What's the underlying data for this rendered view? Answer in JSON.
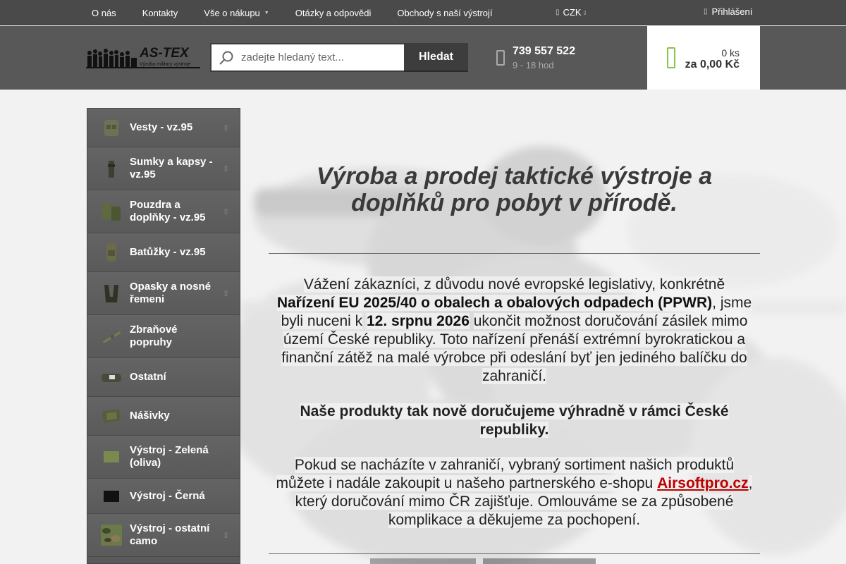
{
  "topnav": {
    "items": [
      {
        "label": "O nás",
        "dropdown": false
      },
      {
        "label": "Kontakty",
        "dropdown": false
      },
      {
        "label": "Vše o nákupu",
        "dropdown": true
      },
      {
        "label": "Otázky a odpovědi",
        "dropdown": false
      },
      {
        "label": "Obchody s naší výstrojí",
        "dropdown": false
      }
    ],
    "currency": "CZK",
    "login": "Přihlášení"
  },
  "header": {
    "logo_text": "AS-TEX",
    "logo_subtext": "Výroba military výstroje",
    "search_placeholder": "zadejte hledaný text...",
    "search_button": "Hledat",
    "phone": "739 557 522",
    "hours": "9 - 18 hod",
    "cart_qty": "0 ks",
    "cart_price": "za 0,00 Kč"
  },
  "sidebar": {
    "items": [
      {
        "label": "Vesty - vz.95",
        "submenu": true,
        "icon": "vest-icon",
        "color": "#6b7353"
      },
      {
        "label": "Sumky a kapsy - vz.95",
        "submenu": true,
        "icon": "pouch-icon",
        "color": "#3d4030"
      },
      {
        "label": "Pouzdra a doplňky - vz.95",
        "submenu": true,
        "icon": "holster-icon",
        "color": "#5e6a3e"
      },
      {
        "label": "Batůžky - vz.95",
        "submenu": false,
        "icon": "backpack-icon",
        "color": "#6b6a4a"
      },
      {
        "label": "Opasky a nosné řemeni",
        "submenu": true,
        "icon": "belt-icon",
        "color": "#2e3324"
      },
      {
        "label": "Zbraňové popruhy",
        "submenu": false,
        "icon": "sling-icon",
        "color": "#7a7a50"
      },
      {
        "label": "Ostatní",
        "submenu": false,
        "icon": "misc-icon",
        "color": "#4a4a3a"
      },
      {
        "label": "Nášivky",
        "submenu": false,
        "icon": "patch-icon",
        "color": "#585c3a"
      },
      {
        "label": "Výstroj - Zelená (oliva)",
        "submenu": false,
        "icon": "olive-swatch-icon",
        "color": "#7a8a4e"
      },
      {
        "label": "Výstroj - Černá",
        "submenu": false,
        "icon": "black-swatch-icon",
        "color": "#111111"
      },
      {
        "label": "Výstroj - ostatní camo",
        "submenu": true,
        "icon": "camo-swatch-icon",
        "color": "#6b7a4a"
      }
    ]
  },
  "content": {
    "headline": "Výroba a prodej taktické výstroje a doplňků pro pobyt v přírodě.",
    "p1_a": "Vážení zákazníci, z důvodu nové evropské legislativy, konkrétně",
    "p1_b": "Nařízení EU 2025/40 o obalech a obalových odpadech (PPWR)",
    "p1_c": ", jsme byli nuceni k",
    "p1_d": "12. srpnu 2026",
    "p1_e": "ukončit možnost doručování zásilek mimo území České republiky. Toto nařízení přenáší extrémní byrokratickou a finanční zátěž na malé výrobce při odeslání byť jen jediného balíčku do zahraničí.",
    "p2": "Naše produkty tak nově doručujeme výhradně v rámci České republiky.",
    "p3_a": "Pokud se nacházíte v zahraničí, vybraný sortiment našich produktů můžete i nadále zakoupit u našeho partnerského e-shopu",
    "p3_link": "Airsoftpro.cz",
    "p3_b": ", který doručování mimo ČR zajišťuje. Omlouváme se za způsobené komplikace a děkujeme za pochopení."
  }
}
